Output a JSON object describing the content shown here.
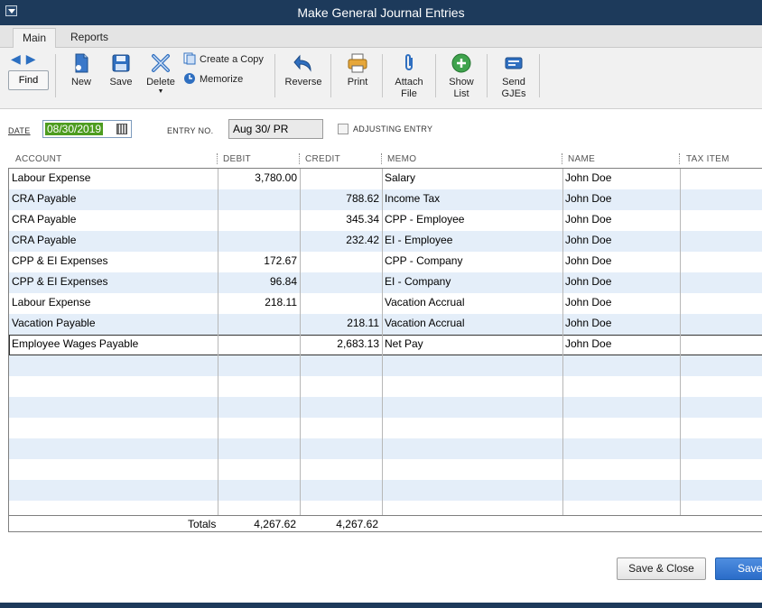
{
  "window": {
    "title": "Make General Journal Entries"
  },
  "ribbon": {
    "tabs": [
      {
        "label": "Main"
      },
      {
        "label": "Reports"
      }
    ],
    "find_label": "Find",
    "buttons": {
      "new": "New",
      "save": "Save",
      "delete": "Delete",
      "create_copy": "Create a Copy",
      "memorize": "Memorize",
      "reverse": "Reverse",
      "print": "Print",
      "attach_line1": "Attach",
      "attach_line2": "File",
      "show_line1": "Show",
      "show_line2": "List",
      "send_line1": "Send",
      "send_line2": "GJEs"
    }
  },
  "form": {
    "date_label": "DATE",
    "date_value": "08/30/2019",
    "entry_no_label": "ENTRY NO.",
    "entry_no_value": "Aug 30/ PR",
    "adjusting_label": "ADJUSTING ENTRY"
  },
  "grid": {
    "headers": {
      "account": "ACCOUNT",
      "debit": "DEBIT",
      "credit": "CREDIT",
      "memo": "MEMO",
      "name": "NAME",
      "tax_item": "TAX ITEM"
    },
    "rows": [
      {
        "account": "Labour Expense",
        "debit": "3,780.00",
        "credit": "",
        "memo": "Salary",
        "name": "John Doe"
      },
      {
        "account": "CRA Payable",
        "debit": "",
        "credit": "788.62",
        "memo": "Income Tax",
        "name": "John Doe"
      },
      {
        "account": "CRA Payable",
        "debit": "",
        "credit": "345.34",
        "memo": "CPP - Employee",
        "name": "John Doe"
      },
      {
        "account": "CRA Payable",
        "debit": "",
        "credit": "232.42",
        "memo": "EI - Employee",
        "name": "John Doe"
      },
      {
        "account": "CPP & EI Expenses",
        "debit": "172.67",
        "credit": "",
        "memo": "CPP - Company",
        "name": "John Doe"
      },
      {
        "account": "CPP & EI Expenses",
        "debit": "96.84",
        "credit": "",
        "memo": "EI - Company",
        "name": "John Doe"
      },
      {
        "account": "Labour Expense",
        "debit": "218.11",
        "credit": "",
        "memo": "Vacation Accrual",
        "name": "John Doe"
      },
      {
        "account": "Vacation Payable",
        "debit": "",
        "credit": "218.11",
        "memo": "Vacation Accrual",
        "name": "John Doe"
      },
      {
        "account": "Employee Wages Payable",
        "debit": "",
        "credit": "2,683.13",
        "memo": "Net Pay",
        "name": "John Doe"
      }
    ],
    "totals_label": "Totals",
    "total_debit": "4,267.62",
    "total_credit": "4,267.62"
  },
  "footer": {
    "save_close_label": "Save & Close",
    "save_new_label": "Save"
  },
  "colors": {
    "titlebar": "#1d3a5b",
    "row_alt": "#e4eef9",
    "date_highlight": "#4d9c1f",
    "primary_button": "#2a6cc8"
  }
}
